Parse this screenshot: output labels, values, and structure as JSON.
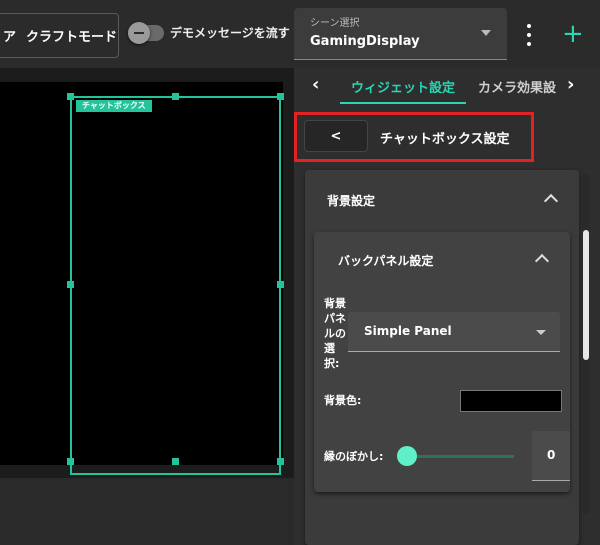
{
  "topbar": {
    "craft_mode_icon": "tools-icon",
    "craft_mode_label": "クラフトモード",
    "demo_toggle_label": "デモメッセージを流す",
    "demo_toggle_on": false,
    "scene_select_caption": "シーン選択",
    "scene_select_value": "GamingDisplay",
    "accent_color": "#28d6b0"
  },
  "preview": {
    "chat_box_tag": "チャットボックス"
  },
  "panel": {
    "tabs": [
      {
        "label": "ウィジェット設定",
        "active": true
      },
      {
        "label": "カメラ効果設",
        "active": false
      }
    ],
    "back_label": "<",
    "settings_title": "チャットボックス設定",
    "background_section": {
      "title": "背景設定",
      "back_panel": {
        "title": "バックパネル設定",
        "select_label": "背景パネルの選択:",
        "select_value": "Simple Panel",
        "color_label": "背景色:",
        "color_value": "#000000",
        "blur_label": "縁のぼかし:",
        "blur_value": "0",
        "blur_level": 0
      }
    }
  }
}
